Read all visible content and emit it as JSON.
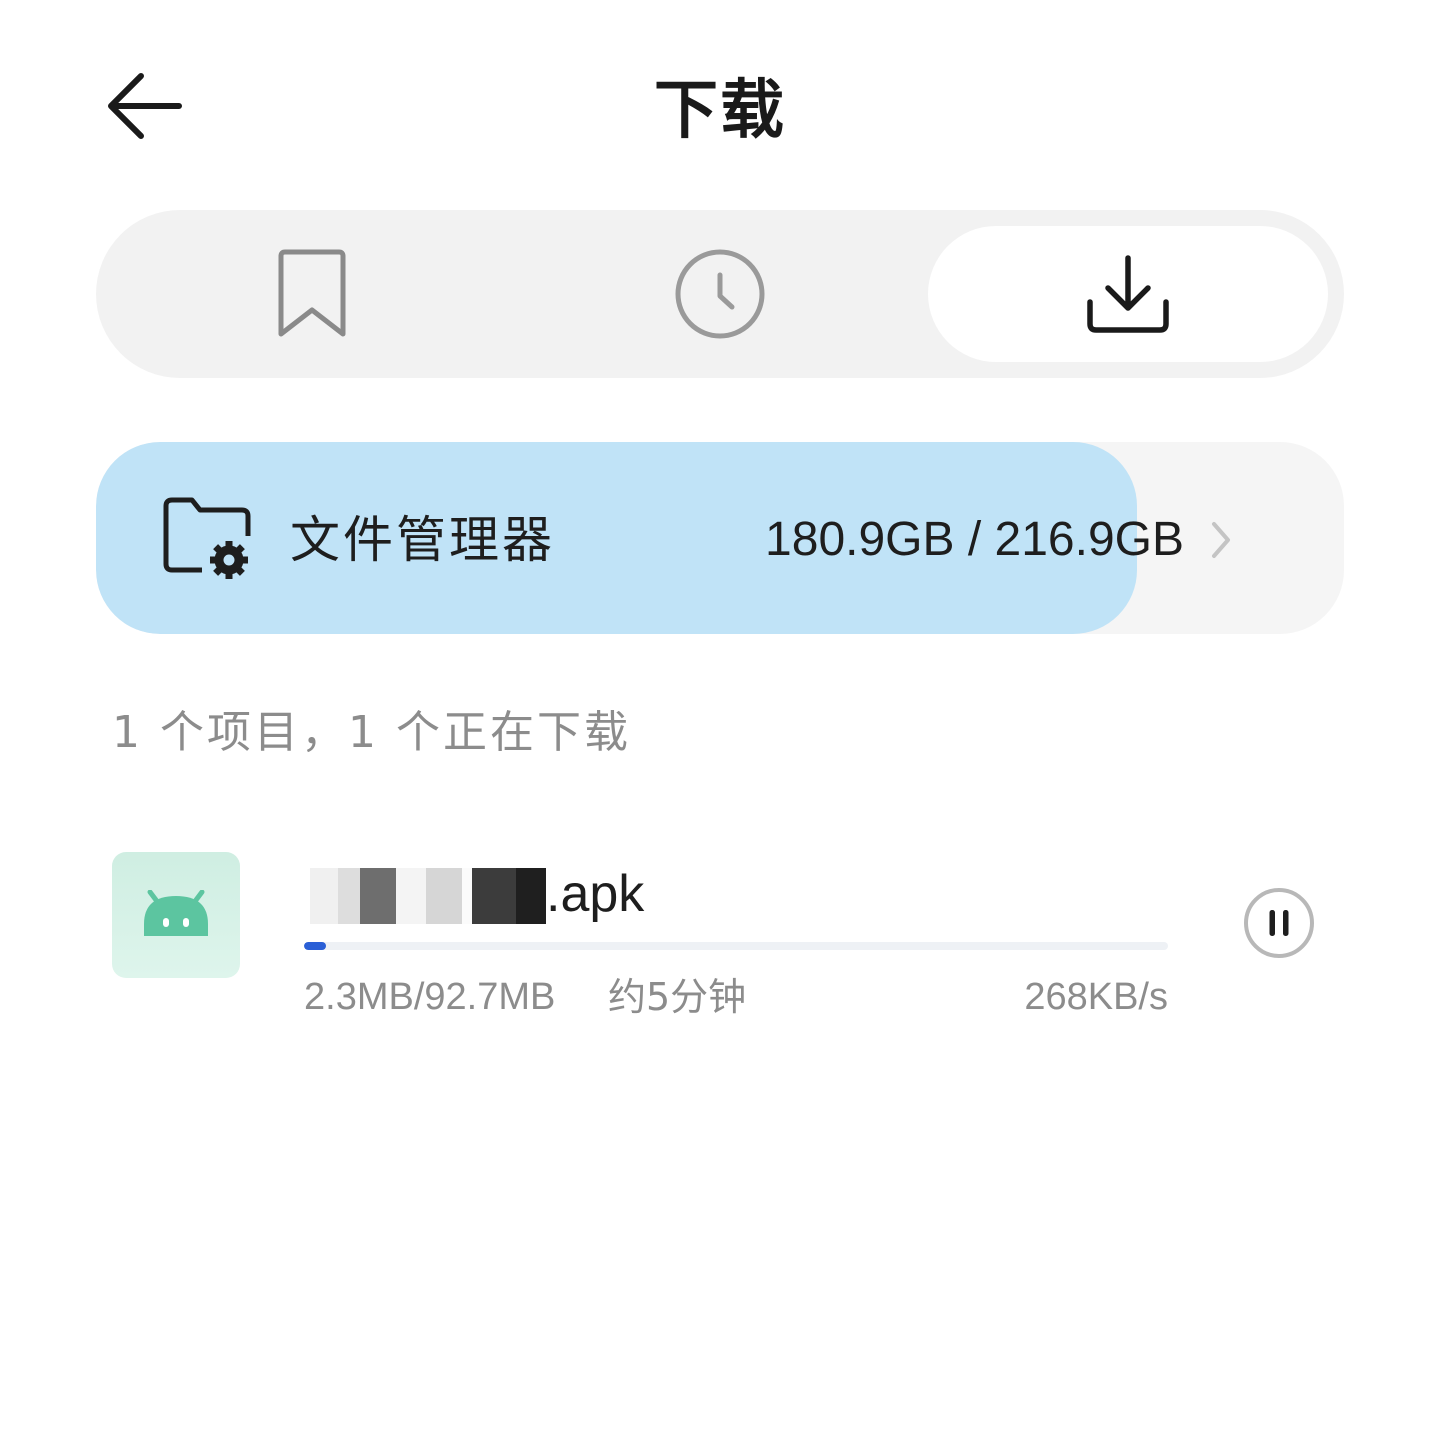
{
  "header": {
    "title": "下载",
    "back_icon": "arrow-left-icon"
  },
  "tabs": [
    {
      "name": "bookmarks",
      "icon": "bookmark-icon",
      "selected": false
    },
    {
      "name": "history",
      "icon": "clock-icon",
      "selected": false
    },
    {
      "name": "downloads",
      "icon": "download-icon",
      "selected": true
    }
  ],
  "storage": {
    "label": "文件管理器",
    "usage": "180.9GB / 216.9GB",
    "used_fraction": 0.834,
    "icon": "folder-settings-icon",
    "fill_color": "#c0e3f7"
  },
  "summary": "1 个项目，1 个正在下载",
  "download": {
    "file_name": ".apk",
    "size_progress": "2.3MB/92.7MB",
    "eta": "约5分钟",
    "speed": "268KB/s",
    "progress_fraction": 0.025,
    "app_icon": "android-icon",
    "action_icon": "pause-icon",
    "accent_color": "#2a5fd6"
  }
}
